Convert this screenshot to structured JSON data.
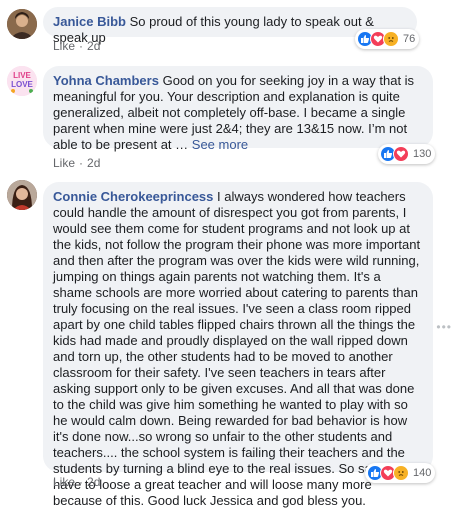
{
  "comments": [
    {
      "author": "Janice Bibb",
      "text": "So proud of this young lady to speak out & speak up",
      "like_label": "Like",
      "time": "2d",
      "reaction_count": "76",
      "reactions": [
        "like-icon",
        "love-icon",
        "sad-icon"
      ]
    },
    {
      "author": "Yohna Chambers",
      "text": "Good on you for seeking joy in a way that is meaningful for you. Your description and explanation is quite generalized, albeit not completely off-base. I became a single parent when mine were just 2&4; they are 13&15 now. I’m not able to be present at …",
      "see_more": "See more",
      "like_label": "Like",
      "time": "2d",
      "reaction_count": "130",
      "reactions": [
        "like-icon",
        "love-icon"
      ]
    },
    {
      "author": "Connie Cherokeeprincess",
      "text": "I always wondered how teachers could handle the amount of disrespect you got from parents, I would see them come for student programs and not look up at the kids, not follow the program their phone was more important and then after the program was over the kids were wild running, jumping on things again parents not watching them. It's a shame schools are more worried about catering to parents than truly focusing on the real issues. I've seen a class room ripped apart by one child tables flipped chairs thrown all the things the kids had made and proudly displayed on the wall ripped down and torn up, the other students had to be moved to another classroom for their safety. I've seen teachers in tears after asking support only to be given excuses. And all that was done to the child was give him something he wanted to play with so he would calm down. Being rewarded for bad behavior is how it's done now...so wrong so unfair to the other students and teachers.... the school system is failing their teachers and the students by turning a blind eye to the real issues. So sad you have to loose a great teacher and will loose many more because of this. Good luck Jessica and god bless you.",
      "like_label": "Like",
      "time": "2d",
      "reaction_count": "140",
      "reactions": [
        "like-icon",
        "love-icon",
        "sad-icon"
      ]
    }
  ]
}
